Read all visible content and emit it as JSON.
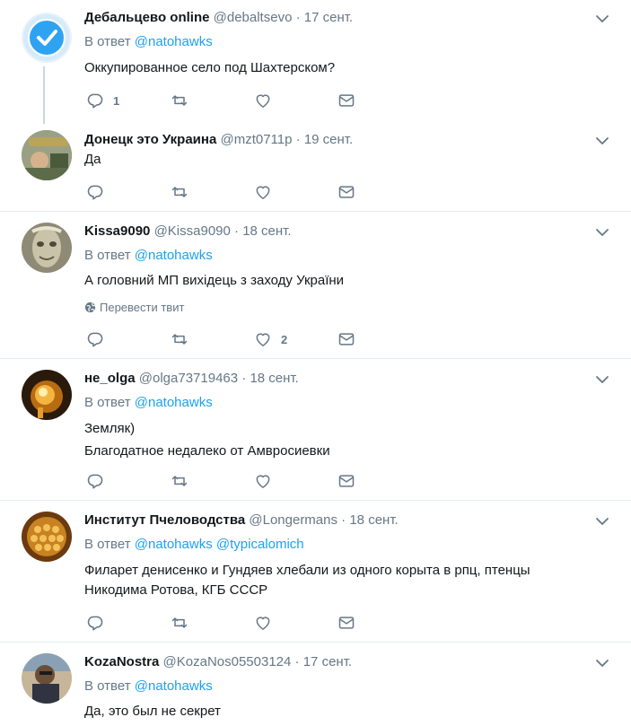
{
  "translate_label": "Перевести твит",
  "reply_prefix": "В ответ",
  "tweets": [
    {
      "name": "Дебальцево online",
      "handle": "@debaltsevo",
      "time": "17 сент.",
      "reply_to": [
        "@natohawks"
      ],
      "lines": [
        "Оккупированное село под Шахтерском?"
      ],
      "reply_count": "1",
      "like_count": "",
      "avatar": "checkmark-badge"
    },
    {
      "name": "Донецк это Украина",
      "handle": "@mzt0711p",
      "time": "19 сент.",
      "reply_to": [],
      "lines": [
        "Да"
      ],
      "reply_count": "",
      "like_count": "",
      "avatar": "photo"
    },
    {
      "name": "Kissa9090",
      "handle": "@Kissa9090",
      "time": "18 сент.",
      "reply_to": [
        "@natohawks"
      ],
      "lines": [
        "А головний МП вихідець з заходу України"
      ],
      "reply_count": "",
      "like_count": "2",
      "avatar": "photo"
    },
    {
      "name": "не_olga",
      "handle": "@olga73719463",
      "time": "18 сент.",
      "reply_to": [
        "@natohawks"
      ],
      "lines": [
        "Земляк)",
        "Благодатное недалеко от Амвросиевки"
      ],
      "reply_count": "",
      "like_count": "",
      "avatar": "photo"
    },
    {
      "name": "Институт Пчеловодства",
      "handle": "@Longermans",
      "time": "18 сент.",
      "reply_to": [
        "@natohawks",
        "@typicalomich"
      ],
      "lines": [
        "Филарет денисенко и Гундяев хлебали из одного корыта в рпц, птенцы",
        "Никодима Ротова, КГБ СССР"
      ],
      "reply_count": "",
      "like_count": "",
      "avatar": "photo"
    },
    {
      "name": "KozaNostra",
      "handle": "@KozaNos05503124",
      "time": "17 сент.",
      "reply_to": [
        "@natohawks"
      ],
      "lines": [
        "Да, это был не секрет"
      ],
      "reply_count": "",
      "like_count": "",
      "avatar": "photo"
    }
  ]
}
